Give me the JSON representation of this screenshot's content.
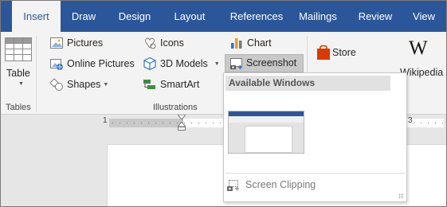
{
  "tabs": [
    {
      "label": "Insert",
      "active": true
    },
    {
      "label": "Draw"
    },
    {
      "label": "Design"
    },
    {
      "label": "Layout"
    },
    {
      "label": "References"
    },
    {
      "label": "Mailings"
    },
    {
      "label": "Review"
    },
    {
      "label": "View"
    }
  ],
  "ribbon": {
    "tables": {
      "table_label": "Table",
      "group_label": "Tables"
    },
    "illustrations": {
      "pictures": "Pictures",
      "online_pictures": "Online Pictures",
      "shapes": "Shapes",
      "icons": "Icons",
      "models_3d": "3D Models",
      "smartart": "SmartArt",
      "chart": "Chart",
      "screenshot": "Screenshot",
      "group_label": "Illustrations"
    },
    "addins": {
      "store": "Store",
      "wikipedia": "Wikipedia"
    }
  },
  "ruler": {
    "left_number": "1",
    "right_number": "3"
  },
  "dropdown": {
    "header": "Available Windows",
    "screen_clipping": "Screen Clipping"
  },
  "colors": {
    "accent": "#2b579a",
    "ribbon_bg": "#f3f3f3",
    "store_icon": "#d83b01"
  }
}
